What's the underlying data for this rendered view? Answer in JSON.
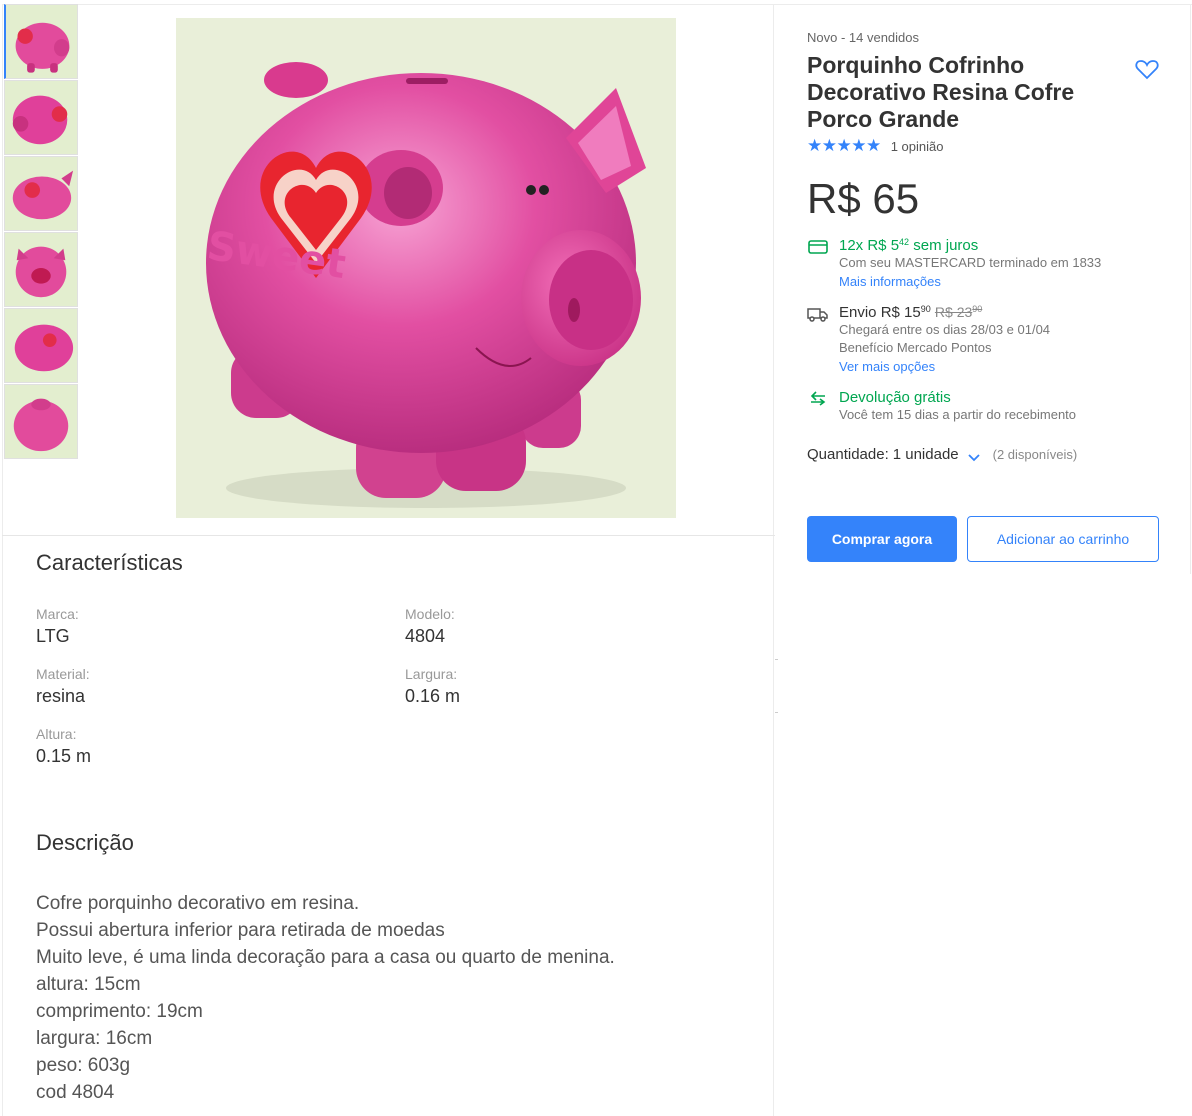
{
  "product": {
    "condition_sold": "Novo  -  14 vendidos",
    "title": "Porquinho Cofrinho Decorativo Resina Cofre Porco Grande",
    "stars": "★★★★★",
    "reviews": "1 opinião",
    "price": "R$ 65"
  },
  "payment": {
    "installments_prefix": "12x R$ 5",
    "installments_cents": "42",
    "installments_suffix": " sem juros",
    "card_note": "Com seu MASTERCARD terminado em 1833",
    "more_info": "Mais informações"
  },
  "shipping": {
    "label": "Envio R$ 15",
    "cents": "90",
    "old_price": "R$ 23",
    "old_cents": "90",
    "arrival": "Chegará entre os dias 28/03 e 01/04",
    "benefit": "Benefício Mercado Pontos",
    "more_options": "Ver mais opções"
  },
  "returns": {
    "label": "Devolução grátis",
    "note": "Você tem 15 dias a partir do recebimento"
  },
  "quantity": {
    "label": "Quantidade:",
    "value": "1 unidade",
    "available": "(2 disponíveis)"
  },
  "buttons": {
    "buy": "Comprar agora",
    "cart": "Adicionar ao carrinho"
  },
  "specs": {
    "title": "Características",
    "items": [
      {
        "label": "Marca:",
        "value": "LTG"
      },
      {
        "label": "Modelo:",
        "value": "4804"
      },
      {
        "label": "Material:",
        "value": "resina"
      },
      {
        "label": "Largura:",
        "value": "0.16 m"
      },
      {
        "label": "Altura:",
        "value": "0.15 m"
      }
    ]
  },
  "description": {
    "title": "Descrição",
    "lines": [
      "Cofre porquinho decorativo em resina.",
      "Possui abertura inferior para retirada de moedas",
      "Muito leve, é uma linda decoração para a casa ou quarto de menina.",
      "altura: 15cm",
      "comprimento: 19cm",
      "largura: 16cm",
      "peso: 603g",
      "cod 4804"
    ]
  },
  "colors": {
    "accent": "#3483fa",
    "green": "#00a650",
    "pig": "#e0489a"
  },
  "icons": [
    "heart-outline-icon",
    "star-icon",
    "card-icon",
    "truck-icon",
    "return-arrow-icon",
    "chevron-down-icon"
  ]
}
